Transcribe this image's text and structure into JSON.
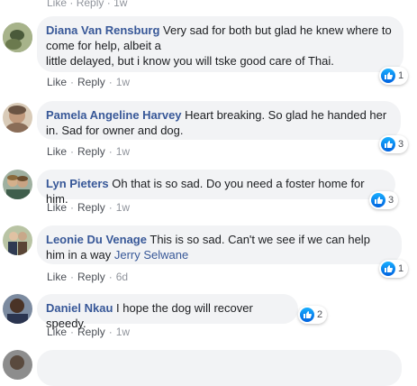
{
  "top": {
    "like": "Like",
    "reply": "Reply",
    "time": "1w"
  },
  "comments": [
    {
      "author": "Diana Van Rensburg",
      "text1": "Very sad for both but glad he knew where to come for help, albeit a",
      "text2": "little delayed, but i know you will tske good care of Thai.",
      "like": "Like",
      "reply": "Reply",
      "time": "1w",
      "reactions": "1"
    },
    {
      "author": "Pamela Angeline Harvey",
      "text1": "Heart breaking. So glad he handed her in. Sad for owner and dog.",
      "like": "Like",
      "reply": "Reply",
      "time": "1w",
      "reactions": "3"
    },
    {
      "author": "Lyn Pieters",
      "text1": "Oh that is so sad. Do you need a foster home for him.",
      "like": "Like",
      "reply": "Reply",
      "time": "1w",
      "reactions": "3"
    },
    {
      "author": "Leonie Du Venage",
      "text1": "This is so sad. Can't we see if we can help him in a way",
      "mention": "Jerry Selwane",
      "like": "Like",
      "reply": "Reply",
      "time": "6d",
      "reactions": "1"
    },
    {
      "author": "Daniel Nkau",
      "text1": "I hope the dog will recover speedy.",
      "like": "Like",
      "reply": "Reply",
      "time": "1w",
      "reactions": "2"
    }
  ],
  "colors": {
    "author": "#385898",
    "bubble": "#f2f3f5",
    "like_icon": "#1877f2"
  }
}
